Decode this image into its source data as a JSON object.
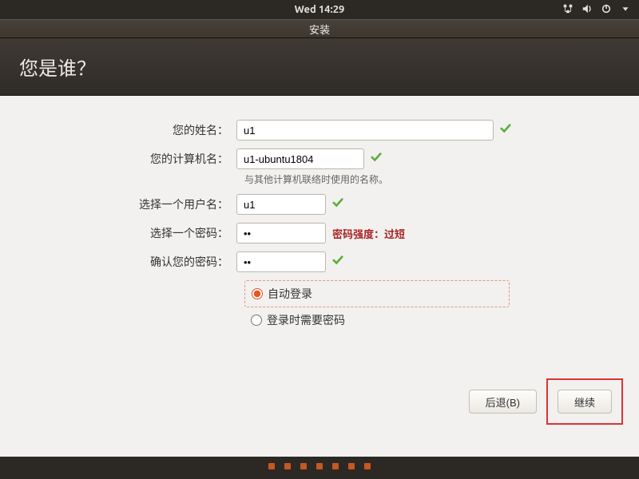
{
  "panel": {
    "clock": "Wed 14:29"
  },
  "window": {
    "title": "安装"
  },
  "header": {
    "title": "您是谁？"
  },
  "form": {
    "name_label": "您的姓名：",
    "name_value": "u1",
    "host_label": "您的计算机名：",
    "host_value": "u1-ubuntu1804",
    "host_hint": "与其他计算机联络时使用的名称。",
    "user_label": "选择一个用户名：",
    "user_value": "u1",
    "pass_label": "选择一个密码：",
    "pass_value": "••",
    "pass_strength": "密码强度：过短",
    "confirm_label": "确认您的密码：",
    "confirm_value": "••",
    "auto_login": "自动登录",
    "require_pass": "登录时需要密码"
  },
  "buttons": {
    "back": "后退(B)",
    "continue": "继续"
  }
}
